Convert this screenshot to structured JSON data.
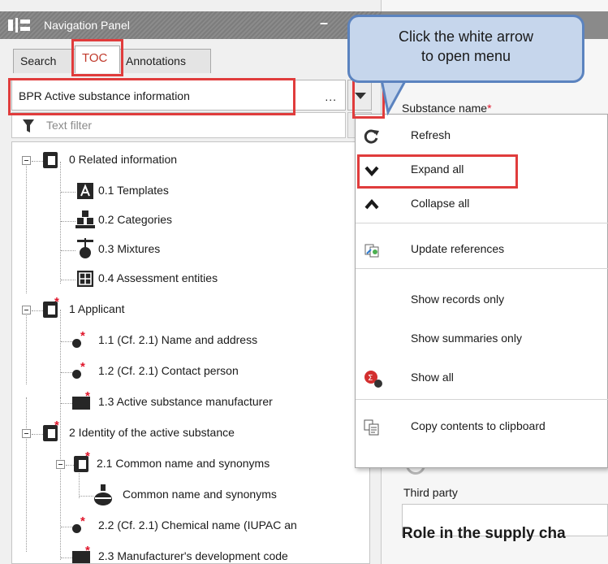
{
  "nav_panel": {
    "title": "Navigation Panel",
    "tabs": [
      {
        "label": "Search",
        "active": false
      },
      {
        "label": "TOC",
        "active": true
      },
      {
        "label": "Annotations",
        "active": false
      }
    ],
    "template_select": {
      "value": "BPR Active substance information",
      "more": "..."
    },
    "filter": {
      "placeholder": "Text filter"
    }
  },
  "tree": [
    {
      "label": "0 Related information",
      "icon": "document-icon",
      "required": false
    },
    {
      "label": "0.1 Templates",
      "icon": "template-icon",
      "required": false
    },
    {
      "label": "0.2 Categories",
      "icon": "categories-icon",
      "required": false
    },
    {
      "label": "0.3 Mixtures",
      "icon": "mixture-icon",
      "required": false
    },
    {
      "label": "0.4 Assessment entities",
      "icon": "assessment-entity-icon",
      "required": false
    },
    {
      "label": "1 Applicant",
      "icon": "document-icon",
      "required": true
    },
    {
      "label": "1.1 (Cf. 2.1) Name and address",
      "icon": "record-dot-icon",
      "required": true
    },
    {
      "label": "1.2 (Cf. 2.1) Contact person",
      "icon": "record-dot-icon",
      "required": true
    },
    {
      "label": "1.3 Active substance manufacturer",
      "icon": "record-rect-icon",
      "required": true
    },
    {
      "label": "2 Identity of the active substance",
      "icon": "document-icon",
      "required": true
    },
    {
      "label": "2.1 Common name and synonyms",
      "icon": "document-icon",
      "required": true
    },
    {
      "label": "Common name and synonyms",
      "icon": "flask-icon",
      "required": false
    },
    {
      "label": "2.2 (Cf. 2.1) Chemical name (IUPAC an",
      "icon": "record-dot-icon",
      "required": true
    },
    {
      "label": "2.3 Manufacturer's development code",
      "icon": "record-rect-icon",
      "required": true
    }
  ],
  "context_menu": {
    "items": [
      {
        "label": "Refresh",
        "icon": "refresh-icon"
      },
      {
        "label": "Expand all",
        "icon": "chevron-down-icon"
      },
      {
        "label": "Collapse all",
        "icon": "chevron-up-icon"
      },
      {
        "label": "Update references",
        "icon": "update-references-icon"
      },
      {
        "label": "Show records only",
        "icon": ""
      },
      {
        "label": "Show summaries only",
        "icon": ""
      },
      {
        "label": "Show all",
        "icon": "sigma-icon"
      },
      {
        "label": "Copy contents to clipboard",
        "icon": "clipboard-icon"
      }
    ]
  },
  "callout": {
    "line1": "Click the white arrow",
    "line2": "to open menu"
  },
  "form": {
    "substance_name_label": "Substance name",
    "required_mark": "*",
    "third_party_label": "Third party",
    "role_heading": "Role in the supply cha"
  },
  "colors": {
    "highlight": "#e03c3c",
    "callout_fill": "#c6d6ec",
    "callout_border": "#5b83bf",
    "required_star": "#e0162b"
  }
}
